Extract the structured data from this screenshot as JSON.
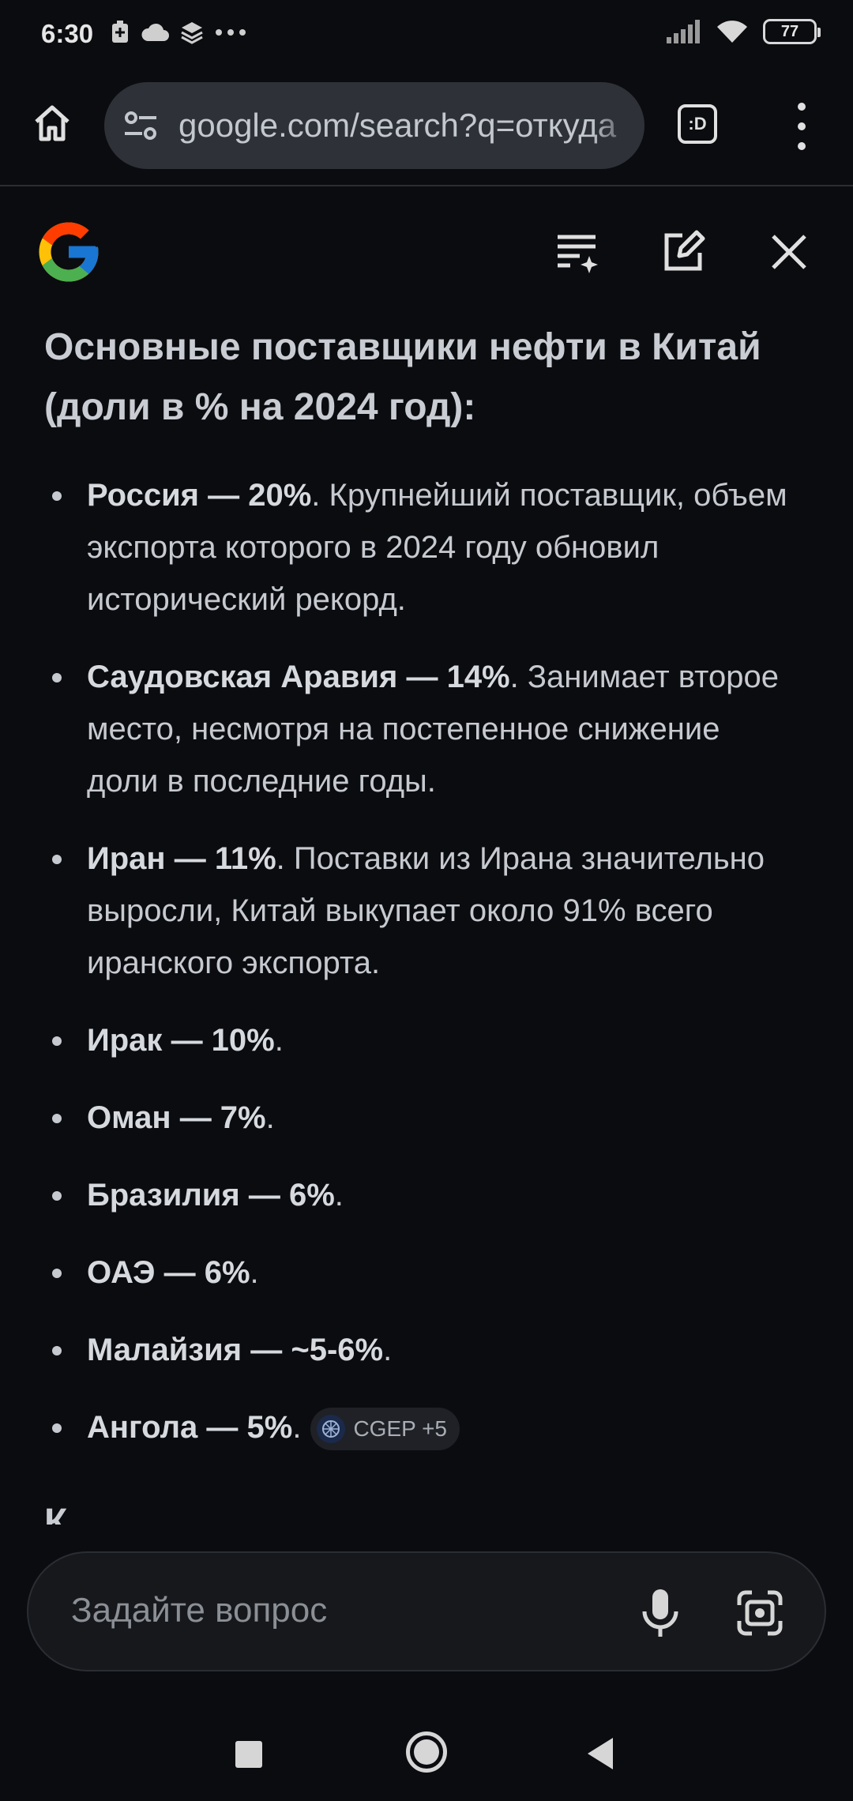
{
  "status_bar": {
    "time": "6:30",
    "battery": "77",
    "icons_left": [
      "battery-saver-icon",
      "cloud-icon",
      "layers-icon",
      "more-dots-icon"
    ],
    "icons_right": [
      "signal-icon",
      "wifi-icon",
      "battery-icon"
    ]
  },
  "browser": {
    "url": "google.com/search?q=откуда",
    "tabs_label": ":D"
  },
  "ai_overview": {
    "heading": "Основные поставщики нефти в Китай (доли в % на 2024 год):",
    "items": [
      {
        "bold": "Россия — 20%",
        "text": ". Крупнейший поставщик, объем экспорта которого в 2024 году обновил исторический рекорд."
      },
      {
        "bold": "Саудовская Аравия — 14%",
        "text": ". Занимает второе место, несмотря на постепенное снижение доли в последние годы."
      },
      {
        "bold": "Иран — 11%",
        "text": ". Поставки из Ирана значительно выросли, Китай выкупает около 91% всего иранского экспорта."
      },
      {
        "bold": "Ирак — 10%",
        "text": "."
      },
      {
        "bold": "Оман — 7%",
        "text": "."
      },
      {
        "bold": "Бразилия — 6%",
        "text": "."
      },
      {
        "bold": "ОАЭ — 6%",
        "text": "."
      },
      {
        "bold": "Малайзия — ~5-6%",
        "text": "."
      },
      {
        "bold": "Ангола — 5%",
        "text": "."
      }
    ],
    "source_chip": "CGEP +5",
    "cut_text": "К"
  },
  "ask_bar": {
    "placeholder": "Задайте вопрос"
  }
}
